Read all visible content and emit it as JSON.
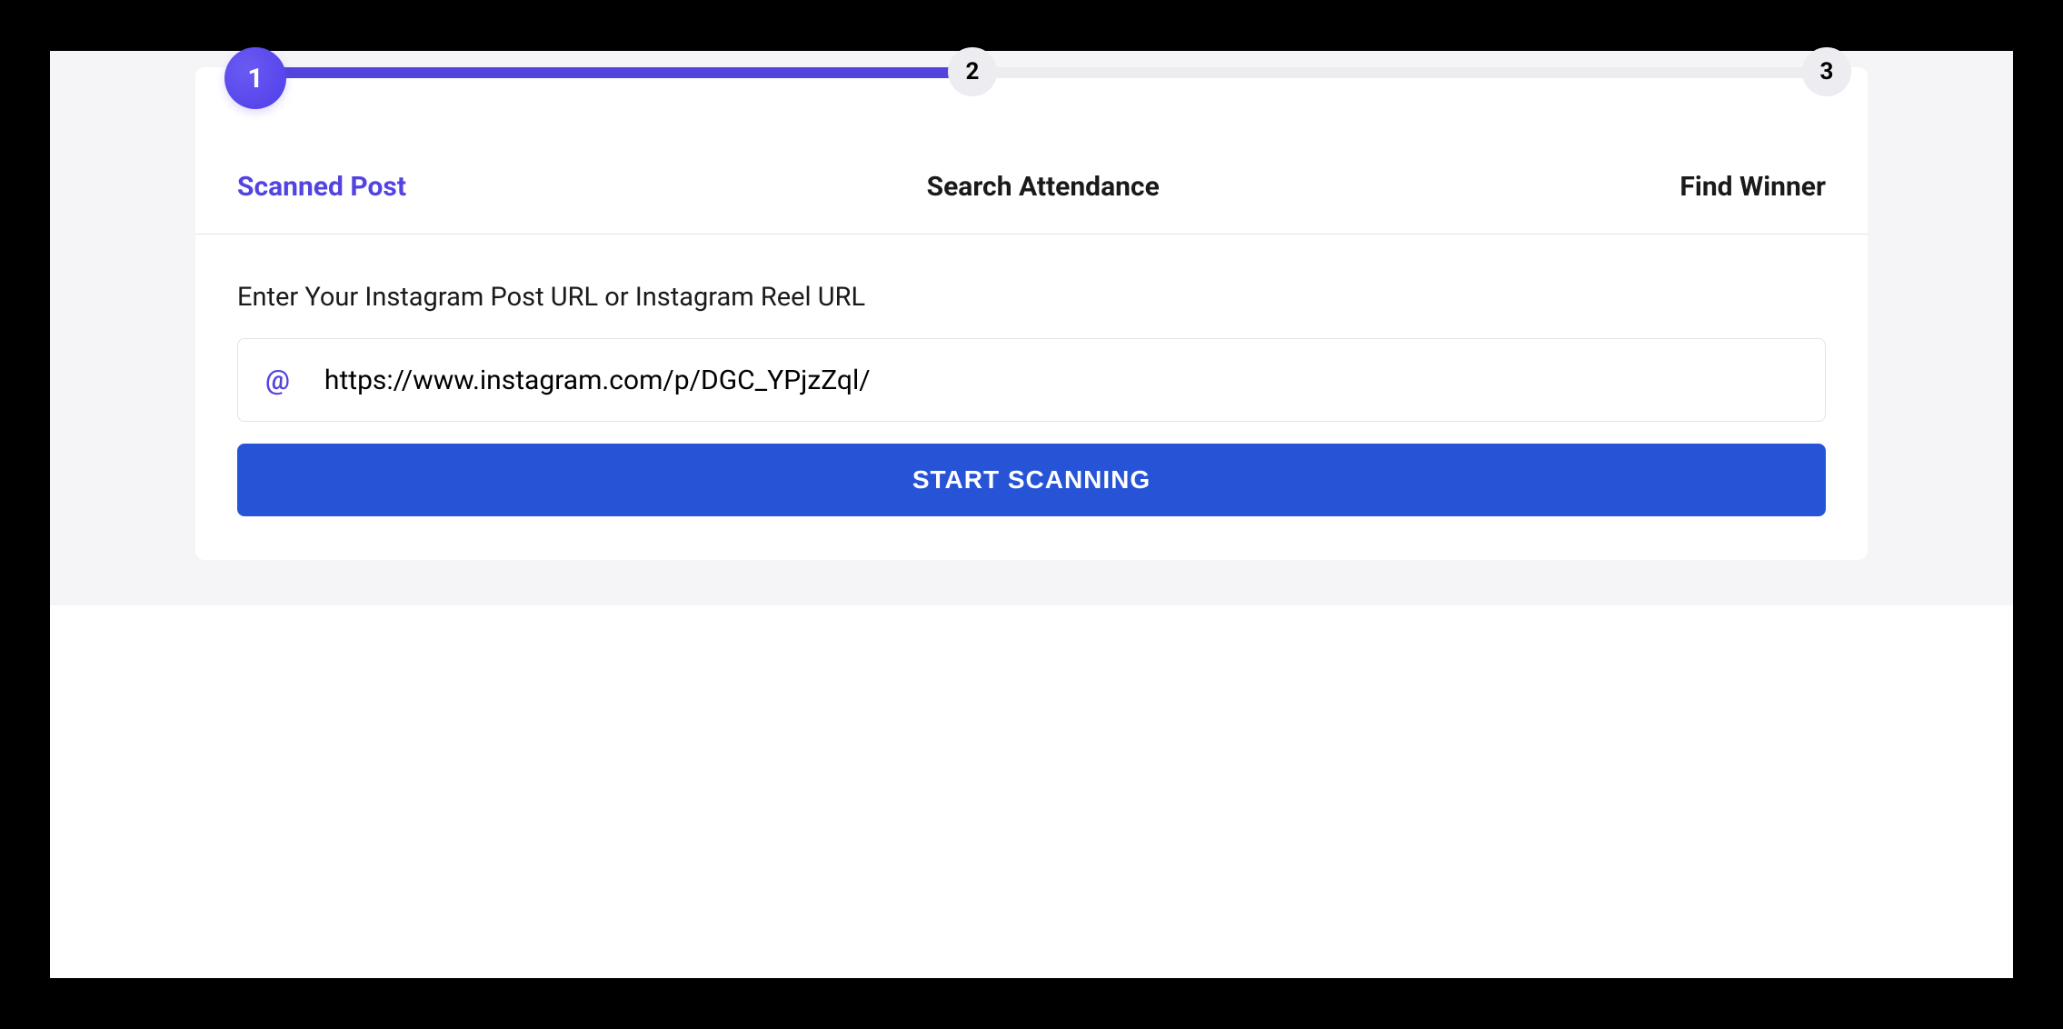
{
  "stepper": {
    "steps": [
      {
        "number": "1",
        "label": "Scanned Post",
        "active": true
      },
      {
        "number": "2",
        "label": "Search Attendance",
        "active": false
      },
      {
        "number": "3",
        "label": "Find Winner",
        "active": false
      }
    ]
  },
  "form": {
    "instruction": "Enter Your Instagram Post URL or Instagram Reel URL",
    "input_value": "https://www.instagram.com/p/DGC_YPjzZql/",
    "submit_label": "START SCANNING"
  }
}
